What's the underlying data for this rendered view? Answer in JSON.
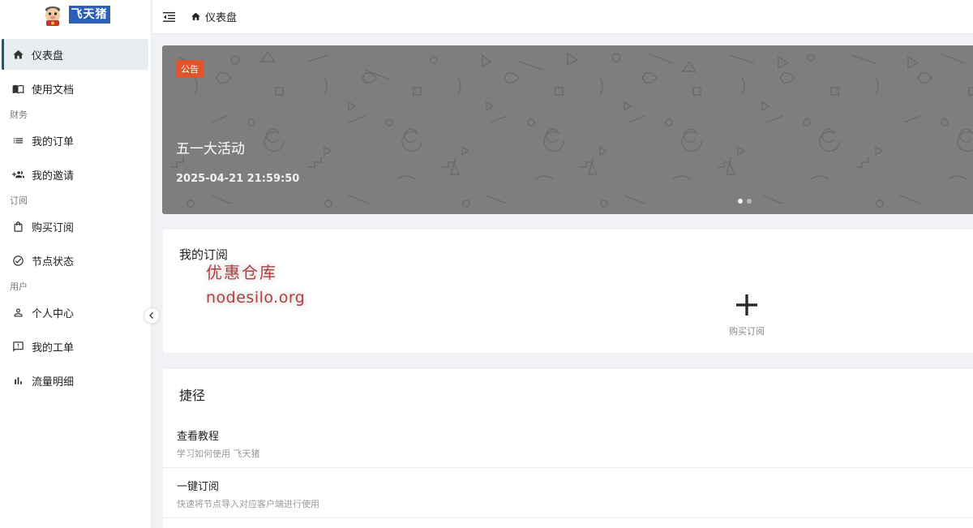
{
  "app": {
    "logo_text": "飞天猪"
  },
  "sidebar": {
    "items": [
      {
        "label": "仪表盘",
        "icon": "home-icon",
        "active": true
      },
      {
        "label": "使用文档",
        "icon": "book-icon"
      }
    ],
    "sections": [
      {
        "title": "财务",
        "items": [
          {
            "label": "我的订单",
            "icon": "list-icon"
          },
          {
            "label": "我的邀请",
            "icon": "people-add-icon"
          }
        ]
      },
      {
        "title": "订阅",
        "items": [
          {
            "label": "购买订阅",
            "icon": "shopping-bag-icon"
          },
          {
            "label": "节点状态",
            "icon": "check-circle-icon"
          }
        ]
      },
      {
        "title": "用户",
        "items": [
          {
            "label": "个人中心",
            "icon": "user-icon"
          },
          {
            "label": "我的工单",
            "icon": "ticket-icon"
          },
          {
            "label": "流量明细",
            "icon": "bar-chart-icon"
          }
        ]
      }
    ]
  },
  "header": {
    "breadcrumb": "仪表盘"
  },
  "banner": {
    "badge": "公告",
    "title": "五一大活动",
    "date": "2025-04-21 21:59:50",
    "slide_count": 2,
    "active_slide": 0
  },
  "subscription": {
    "title": "我的订阅",
    "buy_label": "购买订阅",
    "watermark_line1": "优惠仓库",
    "watermark_line2": "nodesilo.org"
  },
  "shortcuts": {
    "title": "捷径",
    "items": [
      {
        "title": "查看教程",
        "desc": "学习如何使用 飞天猪"
      },
      {
        "title": "一键订阅",
        "desc": "快速将节点导入对应客户端进行使用"
      }
    ]
  }
}
